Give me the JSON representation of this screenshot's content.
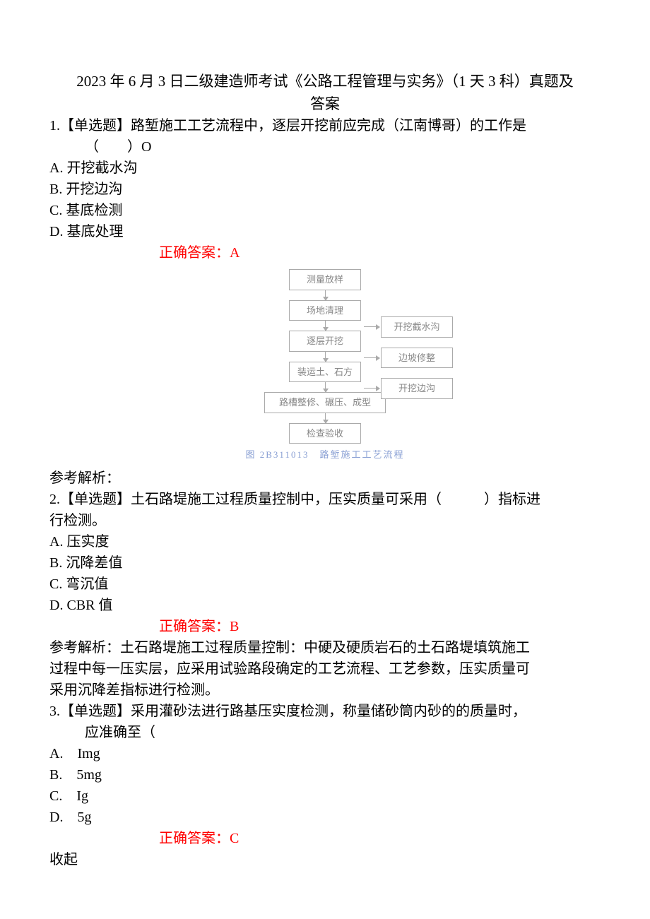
{
  "title_line1": "2023 年 6 月 3 日二级建造师考试《公路工程管理与实务》（1 天 3 科）真题及",
  "title_line2": "答案",
  "q1": {
    "line1": "1.【单选题】路堑施工工艺流程中，逐层开挖前应完成（江南博哥）的工作是",
    "line2": "（　　）O",
    "optA": "A. 开挖截水沟",
    "optB": "B. 开挖边沟",
    "optC": "C. 基底检测",
    "optD": "D. 基底处理",
    "answer": "正确答案：A"
  },
  "flow": {
    "b1": "测量放样",
    "b2": "场地清理",
    "s1": "开挖截水沟",
    "b3": "逐层开挖",
    "s2": "边坡修整",
    "b4": "装运土、石方",
    "s3": "开挖边沟",
    "b5": "路槽整修、碾压、成型",
    "b6": "检查验收",
    "caption": "图 2B311013　路堑施工工艺流程"
  },
  "analysis_label": "参考解析：",
  "q2": {
    "line1": "2.【单选题】土石路堤施工过程质量控制中，压实质量可采用（　　　）指标进",
    "line2": "行检测。",
    "optA": "A. 压实度",
    "optB": "B. 沉降差值",
    "optC": "C. 弯沉值",
    "optD": "D. CBR 值",
    "answer": "正确答案：B",
    "exp1": "参考解析：土石路堤施工过程质量控制：中硬及硬质岩石的土石路堤填筑施工",
    "exp2": "过程中每一压实层，应采用试验路段确定的工艺流程、工艺参数，压实质量可",
    "exp3": "采用沉降差指标进行检测。"
  },
  "q3": {
    "line1": "3.【单选题】采用灌砂法进行路基压实度检测，称量储砂筒内砂的的质量时，",
    "line2": "应准确至（",
    "optA": "A.　Img",
    "optB": "B.　5mg",
    "optC": "C.　Ig",
    "optD": "D.　5g",
    "answer": "正确答案：C",
    "collapse": "收起"
  }
}
